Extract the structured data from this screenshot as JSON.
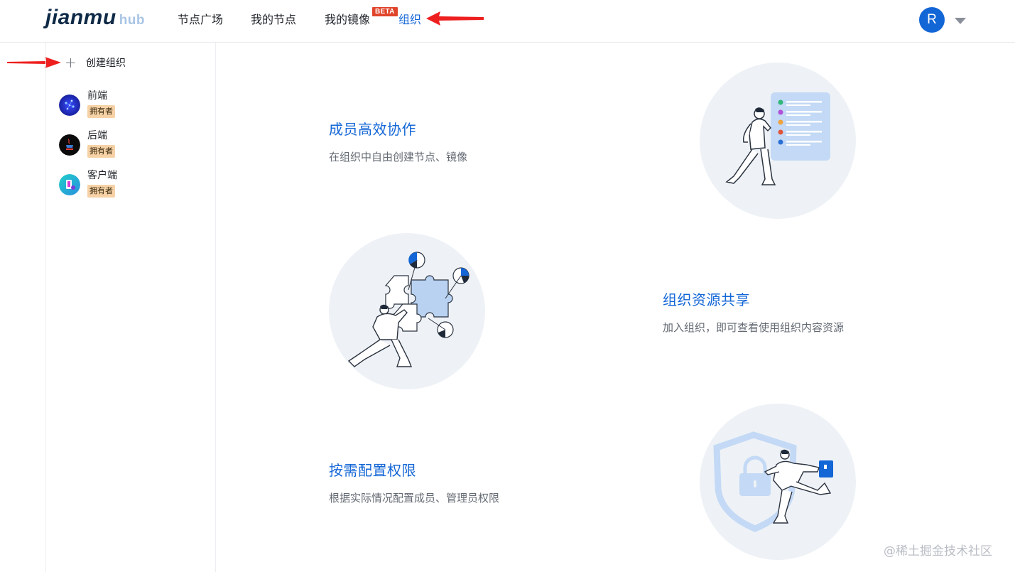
{
  "header": {
    "logo_main": "jianmu",
    "logo_sub": "hub",
    "nav": [
      {
        "label": "节点广场"
      },
      {
        "label": "我的节点"
      },
      {
        "label": "我的镜像"
      },
      {
        "label": "组织"
      }
    ],
    "beta_badge": "BETA",
    "active_nav": "组织",
    "user_initial": "R",
    "accent_color": "#1366d6"
  },
  "sidebar": {
    "create_label": "创建组织",
    "orgs": [
      {
        "name": "前端",
        "role": "拥有者"
      },
      {
        "name": "后端",
        "role": "拥有者"
      },
      {
        "name": "客户端",
        "role": "拥有者"
      }
    ]
  },
  "features": [
    {
      "title": "成员高效协作",
      "desc": "在组织中自由创建节点、镜像"
    },
    {
      "title": "组织资源共享",
      "desc": "加入组织，即可查看使用组织内容资源"
    },
    {
      "title": "按需配置权限",
      "desc": "根据实际情况配置成员、管理员权限"
    }
  ],
  "watermark": "@稀土掘金技术社区"
}
